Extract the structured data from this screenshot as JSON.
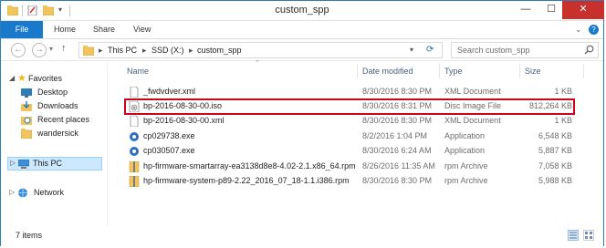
{
  "window": {
    "title": "custom_spp",
    "controls": {
      "minimize": "—",
      "maximize": "☐",
      "close": "✕"
    }
  },
  "ribbon": {
    "tabs": [
      "File",
      "Home",
      "Share",
      "View"
    ],
    "help_icon": "?",
    "collapse_icon": "⌄"
  },
  "address": {
    "crumbs": [
      "This PC",
      "SSD (X:)",
      "custom_spp"
    ],
    "separator": "▸",
    "search_placeholder": "Search custom_spp"
  },
  "nav": {
    "favorites_label": "Favorites",
    "favorites": [
      "Desktop",
      "Downloads",
      "Recent places",
      "wandersick"
    ],
    "this_pc": "This PC",
    "network": "Network"
  },
  "columns": {
    "name": "Name",
    "date_modified": "Date modified",
    "type": "Type",
    "size": "Size"
  },
  "files": [
    {
      "name": "_fwdvdver.xml",
      "date": "8/30/2016 8:30 PM",
      "type": "XML Document",
      "size": "1 KB",
      "icon": "xml-file-icon"
    },
    {
      "name": "bp-2016-08-30-00.iso",
      "date": "8/30/2016 8:31 PM",
      "type": "Disc Image File",
      "size": "812,264 KB",
      "icon": "disc-image-icon"
    },
    {
      "name": "bp-2016-08-30-00.xml",
      "date": "8/30/2016 8:30 PM",
      "type": "XML Document",
      "size": "1 KB",
      "icon": "xml-file-icon"
    },
    {
      "name": "cp029738.exe",
      "date": "8/2/2016 1:04 PM",
      "type": "Application",
      "size": "6,548 KB",
      "icon": "application-gear-icon"
    },
    {
      "name": "cp030507.exe",
      "date": "8/30/2016 6:24 AM",
      "type": "Application",
      "size": "5,887 KB",
      "icon": "application-gear-icon"
    },
    {
      "name": "hp-firmware-smartarray-ea3138d8e8-4.02-2.1.x86_64.rpm",
      "date": "8/26/2016 11:35 AM",
      "type": "rpm Archive",
      "size": "7,058 KB",
      "icon": "rpm-archive-icon"
    },
    {
      "name": "hp-firmware-system-p89-2.22_2016_07_18-1.1.i386.rpm",
      "date": "8/30/2016 8:30 PM",
      "type": "rpm Archive",
      "size": "5,988 KB",
      "icon": "rpm-archive-icon"
    }
  ],
  "status": {
    "item_count": "7 items"
  },
  "colors": {
    "accent": "#1979ca",
    "highlight_box": "#d0021b",
    "close": "#c7302b",
    "folder": "#f2c55c"
  }
}
